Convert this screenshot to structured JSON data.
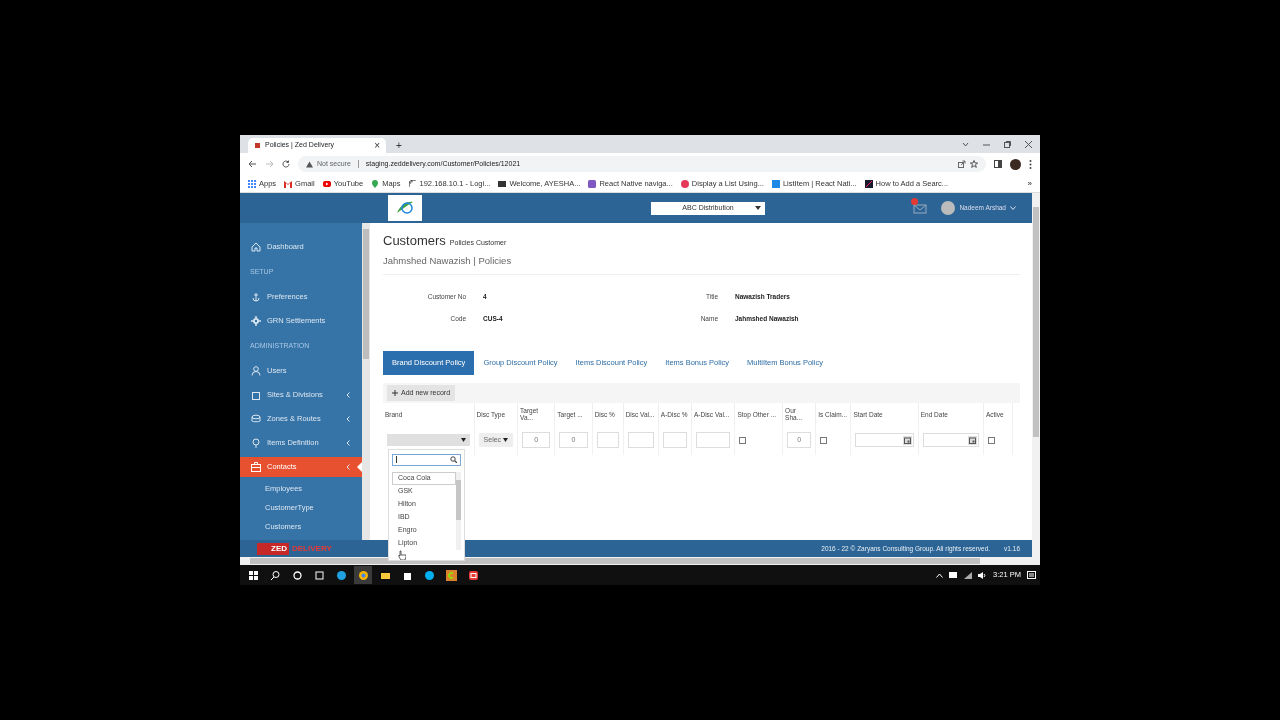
{
  "browser": {
    "tab_title": "Policies | Zed Delivery",
    "tab_close": "×",
    "new_tab": "+",
    "security": "Not secure",
    "url": "staging.zeddelivery.com/Customer/Policies/12021",
    "bookmarks": [
      "Apps",
      "Gmail",
      "YouTube",
      "Maps",
      "192.168.10.1 - Logi...",
      "Welcome, AYESHA...",
      "React Native naviga...",
      "Display a List Using...",
      "ListItem | React Nati...",
      "How to Add a Searc..."
    ],
    "more": "»"
  },
  "header": {
    "company": "ABC Distribution",
    "user": "Nadeem Arshad"
  },
  "sidebar": {
    "items": [
      {
        "kind": "item",
        "label": "Dashboard",
        "has_submenu": false,
        "selected": false
      },
      {
        "kind": "section",
        "label": "SETUP"
      },
      {
        "kind": "item",
        "label": "Preferences",
        "has_submenu": false,
        "selected": false
      },
      {
        "kind": "item",
        "label": "GRN Settlements",
        "has_submenu": false,
        "selected": false
      },
      {
        "kind": "section",
        "label": "ADMINISTRATION"
      },
      {
        "kind": "item",
        "label": "Users",
        "has_submenu": false,
        "selected": false
      },
      {
        "kind": "item",
        "label": "Sites & Divisions",
        "has_submenu": true,
        "selected": false
      },
      {
        "kind": "item",
        "label": "Zones & Routes",
        "has_submenu": true,
        "selected": false
      },
      {
        "kind": "item",
        "label": "Items Definition",
        "has_submenu": true,
        "selected": false
      },
      {
        "kind": "item",
        "label": "Contacts",
        "has_submenu": true,
        "selected": true,
        "children": [
          {
            "label": "Employees"
          },
          {
            "label": "CustomerType"
          },
          {
            "label": "Customers"
          }
        ]
      }
    ],
    "logo_word_1": "ZED",
    "logo_word_2": "DELIVERY"
  },
  "page": {
    "title": "Customers",
    "subtitle": "Policies Customer",
    "breadcrumb": "Jahmshed Nawazish | Policies"
  },
  "fields": [
    {
      "label": "Customer No",
      "value": "4"
    },
    {
      "label": "Title",
      "value": "Nawazish Traders"
    },
    {
      "label": "Code",
      "value": "CUS-4"
    },
    {
      "label": "Name",
      "value": "Jahmshed Nawazish"
    }
  ],
  "tabs": [
    {
      "label": "Brand Discount Policy",
      "selected": true
    },
    {
      "label": "Group Discount Policy",
      "selected": false
    },
    {
      "label": "Items Discount Policy",
      "selected": false
    },
    {
      "label": "Items Bonus Policy",
      "selected": false
    },
    {
      "label": "MultiItem Bonus Policy",
      "selected": false
    }
  ],
  "grid": {
    "add_button": "Add new record",
    "columns": [
      "Brand",
      "Disc Type",
      "Target Va...",
      "Target ...",
      "Disc %",
      "Disc Val...",
      "A-Disc %",
      "A-Disc Val...",
      "Stop Other ...",
      "Our Sha...",
      "Is Claim...",
      "Start Date",
      "End Date",
      "Active"
    ],
    "row": [
      {
        "kind": "dropdown"
      },
      {
        "kind": "select",
        "value": "Selec"
      },
      {
        "kind": "number",
        "value": "0"
      },
      {
        "kind": "number",
        "value": "0"
      },
      {
        "kind": "input"
      },
      {
        "kind": "input"
      },
      {
        "kind": "input"
      },
      {
        "kind": "input"
      },
      {
        "kind": "checkbox",
        "checked": false
      },
      {
        "kind": "number",
        "value": "0"
      },
      {
        "kind": "checkbox",
        "checked": false
      },
      {
        "kind": "date"
      },
      {
        "kind": "date"
      },
      {
        "kind": "checkbox",
        "checked": false
      }
    ],
    "brand_options": [
      {
        "label": "Coca Cola",
        "selected": true
      },
      {
        "label": "GSK",
        "selected": false
      },
      {
        "label": "Hilton",
        "selected": false
      },
      {
        "label": "IBD",
        "selected": false
      },
      {
        "label": "Engro",
        "selected": false
      },
      {
        "label": "Lipton",
        "selected": false
      }
    ]
  },
  "footer": {
    "copyright": "2016 - 22 © Zaryans Consulting Group. All rights reserved.",
    "version": "v1.16"
  },
  "taskbar": {
    "time": "3:21 PM"
  }
}
